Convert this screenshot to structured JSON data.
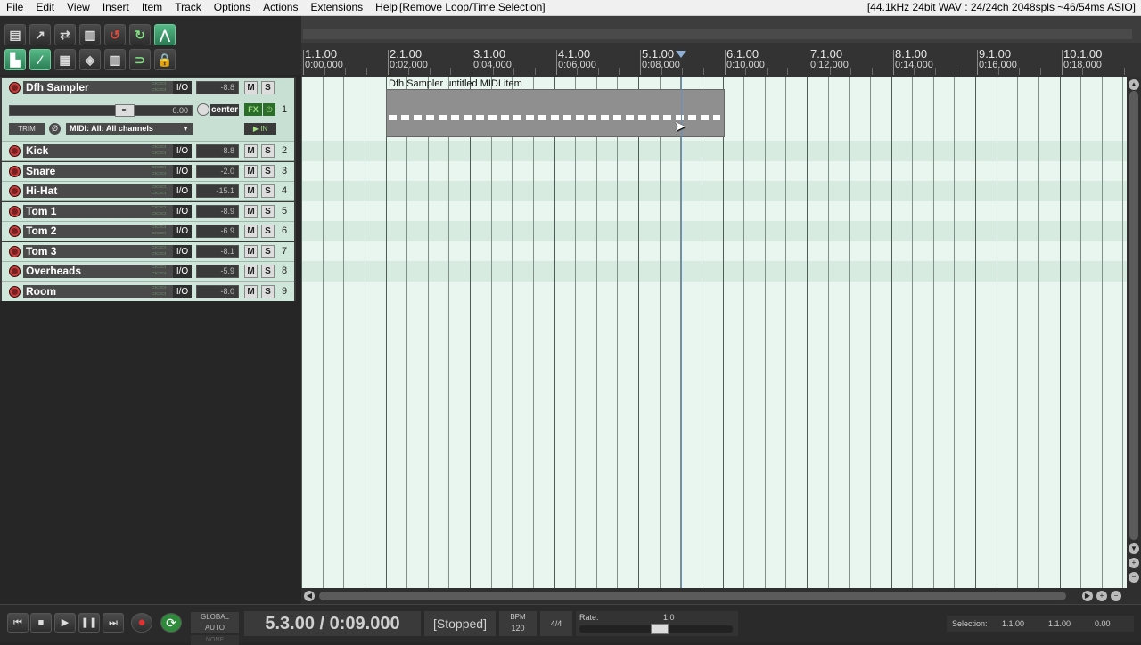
{
  "menu": {
    "items": [
      "File",
      "Edit",
      "View",
      "Insert",
      "Item",
      "Track",
      "Options",
      "Actions",
      "Extensions",
      "Help"
    ],
    "last_action": "[Remove Loop/Time Selection]",
    "audio_status": "[44.1kHz 24bit WAV : 24/24ch 2048spls ~46/54ms ASIO]"
  },
  "ruler": {
    "marks": [
      {
        "bar": "1.1.00",
        "time": "0:00.000"
      },
      {
        "bar": "2.1.00",
        "time": "0:02.000"
      },
      {
        "bar": "3.1.00",
        "time": "0:04.000"
      },
      {
        "bar": "4.1.00",
        "time": "0:06.000"
      },
      {
        "bar": "5.1.00",
        "time": "0:08.000"
      },
      {
        "bar": "6.1.00",
        "time": "0:10.000"
      },
      {
        "bar": "7.1.00",
        "time": "0:12.000"
      },
      {
        "bar": "8.1.00",
        "time": "0:14.000"
      },
      {
        "bar": "9.1.00",
        "time": "0:16.000"
      },
      {
        "bar": "10.1.00",
        "time": "0:18.000"
      }
    ]
  },
  "master_track": {
    "name": "Dfh Sampler",
    "io": "I/O",
    "volume": "-8.8",
    "mute": "M",
    "solo": "S",
    "number": "1",
    "fader_value": "0.00",
    "pan": "center",
    "fx": "FX",
    "fx_power": "⏻",
    "trim": "TRIM",
    "phase": "Ø",
    "midi_input": "MIDI: All: All channels",
    "input_monitor": "IN"
  },
  "tracks": [
    {
      "name": "Kick",
      "volume": "-8.8",
      "number": "2"
    },
    {
      "name": "Snare",
      "volume": "-2.0",
      "number": "3"
    },
    {
      "name": "Hi-Hat",
      "volume": "-15.1",
      "number": "4"
    },
    {
      "name": "Tom 1",
      "volume": "-8.9",
      "number": "5"
    },
    {
      "name": "Tom 2",
      "volume": "-6.9",
      "number": "6"
    },
    {
      "name": "Tom 3",
      "volume": "-8.1",
      "number": "7"
    },
    {
      "name": "Overheads",
      "volume": "-5.9",
      "number": "8"
    },
    {
      "name": "Room",
      "volume": "-8.0",
      "number": "9"
    }
  ],
  "track_labels": {
    "io": "I/O",
    "mute": "M",
    "solo": "S"
  },
  "midi_item": {
    "label": "Dfh Sampler untitled MIDI item"
  },
  "transport": {
    "position": "5.3.00 / 0:09.000",
    "state": "[Stopped]",
    "bpm_label": "BPM",
    "bpm": "120",
    "time_signature": "4/4",
    "rate_label": "Rate:",
    "rate": "1.0",
    "global_auto": "GLOBAL AUTO",
    "global_auto_value": "NONE",
    "selection_label": "Selection:",
    "selection_start": "1.1.00",
    "selection_end": "1.1.00",
    "selection_length": "0.00"
  }
}
